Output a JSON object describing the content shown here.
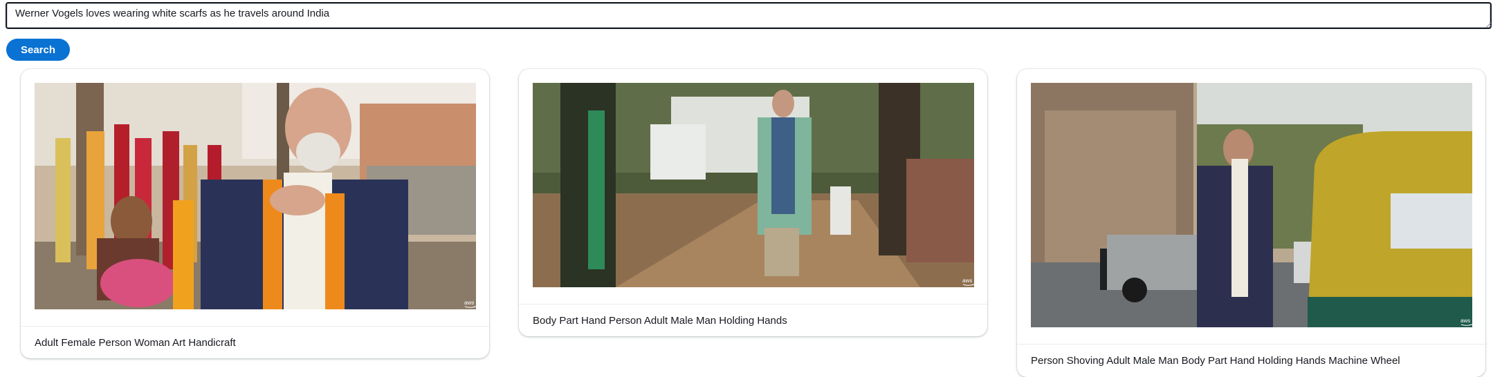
{
  "search": {
    "query": "Werner Vogels loves wearing white scarfs as he travels around India",
    "button_label": "Search"
  },
  "results": [
    {
      "caption": "Adult Female Person Woman Art Handicraft",
      "logo_text": "aws",
      "scene": "flower-market"
    },
    {
      "caption": "Body Part Hand Person Adult Male Man Holding Hands",
      "logo_text": "aws",
      "scene": "village-street"
    },
    {
      "caption": "Person Shoving Adult Male Man Body Part Hand Holding Hands Machine Wheel",
      "logo_text": "aws",
      "scene": "temple-rickshaw"
    }
  ],
  "colors": {
    "primary_button": "#0972d3",
    "border": "#16191f"
  }
}
